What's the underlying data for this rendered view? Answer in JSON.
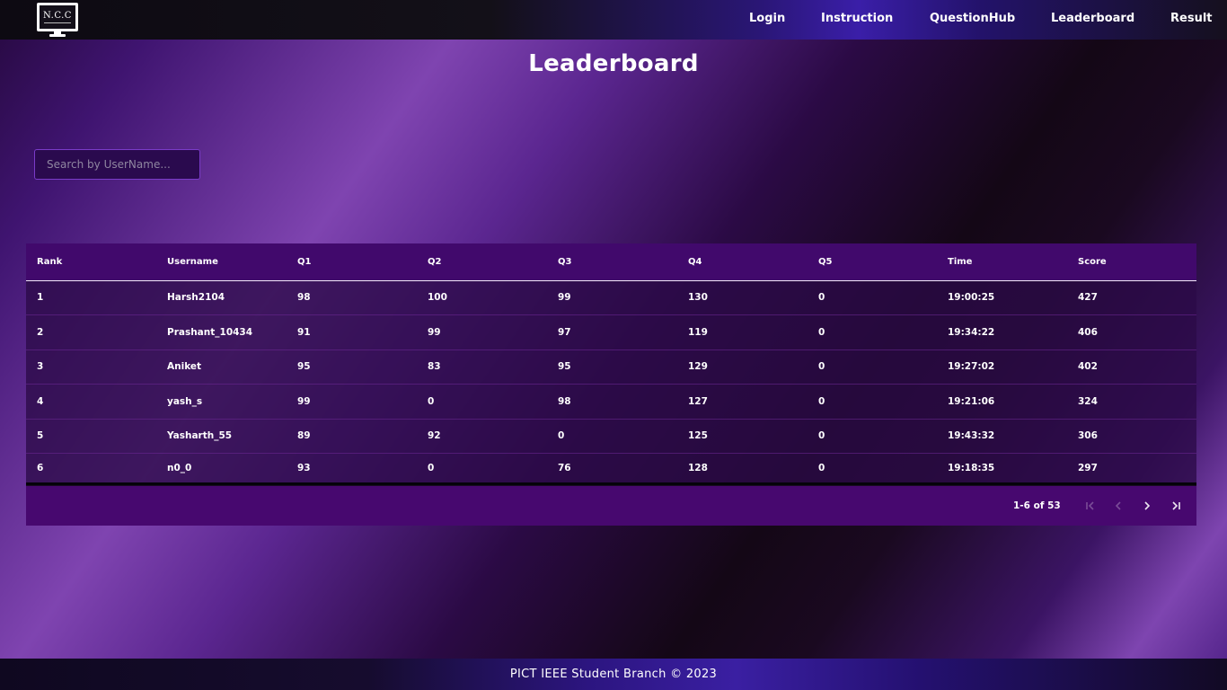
{
  "nav": {
    "logo_text": "N.C.C",
    "links": [
      "Login",
      "Instruction",
      "QuestionHub",
      "Leaderboard",
      "Result"
    ]
  },
  "page": {
    "title": "Leaderboard"
  },
  "search": {
    "placeholder": "Search by UserName...",
    "value": ""
  },
  "table": {
    "columns": [
      "Rank",
      "Username",
      "Q1",
      "Q2",
      "Q3",
      "Q4",
      "Q5",
      "Time",
      "Score"
    ],
    "rows": [
      [
        "1",
        "Harsh2104",
        "98",
        "100",
        "99",
        "130",
        "0",
        "19:00:25",
        "427"
      ],
      [
        "2",
        "Prashant_10434",
        "91",
        "99",
        "97",
        "119",
        "0",
        "19:34:22",
        "406"
      ],
      [
        "3",
        "Aniket",
        "95",
        "83",
        "95",
        "129",
        "0",
        "19:27:02",
        "402"
      ],
      [
        "4",
        "yash_s",
        "99",
        "0",
        "98",
        "127",
        "0",
        "19:21:06",
        "324"
      ],
      [
        "5",
        "Yasharth_55",
        "89",
        "92",
        "0",
        "125",
        "0",
        "19:43:32",
        "306"
      ],
      [
        "6",
        "n0_0",
        "93",
        "0",
        "76",
        "128",
        "0",
        "19:18:35",
        "297"
      ]
    ]
  },
  "pagination": {
    "range_label": "1-6 of 53",
    "first_icon": "first-page-icon",
    "prev_icon": "chevron-left-icon",
    "next_icon": "chevron-right-icon",
    "last_icon": "last-page-icon"
  },
  "footer": {
    "text": "PICT IEEE Student Branch © 2023"
  }
}
